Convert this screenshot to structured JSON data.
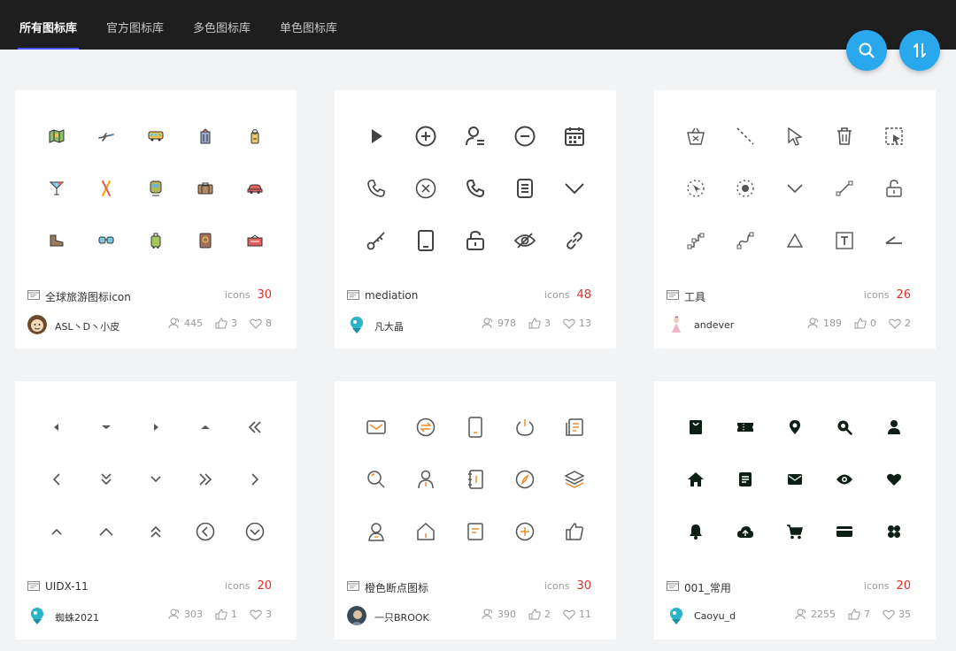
{
  "nav": {
    "tabs": [
      {
        "label": "所有图标库",
        "active": true
      },
      {
        "label": "官方图标库",
        "active": false
      },
      {
        "label": "多色图标库",
        "active": false
      },
      {
        "label": "单色图标库",
        "active": false
      }
    ],
    "search_icon": "search-icon",
    "sort_icon": "sort-icon"
  },
  "cards": [
    {
      "title": "全球旅游图标icon",
      "count_label": "icons",
      "count": "30",
      "author": "ASL丶D丶小皮",
      "views": "445",
      "likes": "3",
      "favorites": "8"
    },
    {
      "title": "mediation",
      "count_label": "icons",
      "count": "48",
      "author": "凡大晶",
      "views": "978",
      "likes": "3",
      "favorites": "13"
    },
    {
      "title": "工具",
      "count_label": "icons",
      "count": "26",
      "author": "andever",
      "views": "189",
      "likes": "0",
      "favorites": "2"
    },
    {
      "title": "UIDX-11",
      "count_label": "icons",
      "count": "20",
      "author": "蜘蛛2021",
      "views": "303",
      "likes": "1",
      "favorites": "3"
    },
    {
      "title": "橙色断点图标",
      "count_label": "icons",
      "count": "30",
      "author": "一只BROOK",
      "views": "390",
      "likes": "2",
      "favorites": "11"
    },
    {
      "title": "001_常用",
      "count_label": "icons",
      "count": "20",
      "author": "Caoyu_d",
      "views": "2255",
      "likes": "7",
      "favorites": "35"
    }
  ],
  "colors": {
    "topbar": "#1e1e1e",
    "active_underline": "#4b52ff",
    "fab": "#29a8ee",
    "count_number": "#e0302d",
    "page_background": "#f2f3f5"
  }
}
